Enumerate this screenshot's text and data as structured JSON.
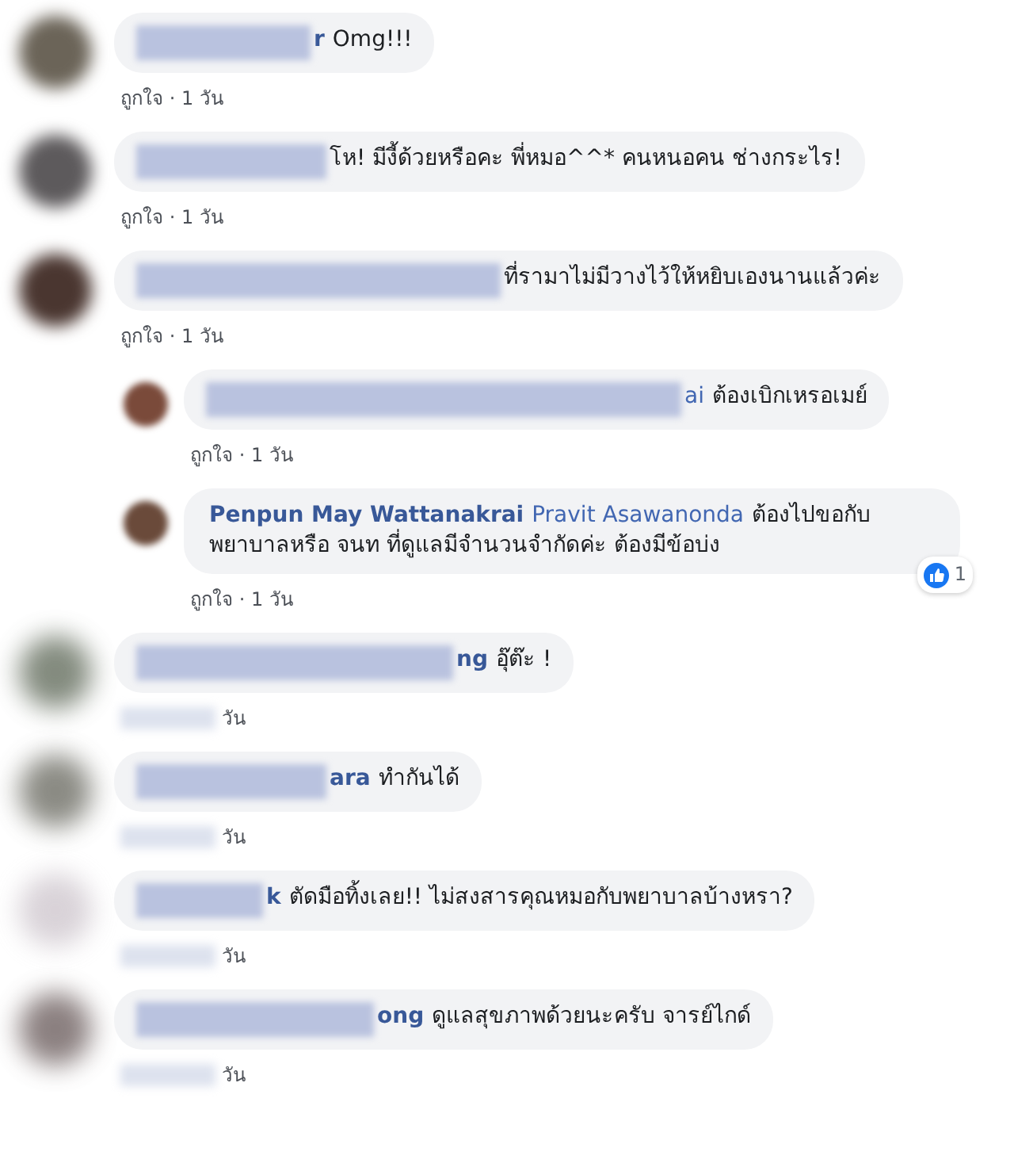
{
  "comments": [
    {
      "kind": "comment",
      "obscured": false,
      "name": "r",
      "text": "Omg!!!",
      "meta": "ถูกใจ · 1 วัน"
    },
    {
      "kind": "comment",
      "obscured": false,
      "text": "โห! มีงี้ด้วยหรือคะ พี่หมอ^^* คนหนอคน ช่างกระไร!",
      "meta": "ถูกใจ · 1 วัน"
    },
    {
      "kind": "comment",
      "obscured": false,
      "text": "ที่รามาไม่มีวางไว้ให้หยิบเองนานแล้วค่ะ",
      "meta": "ถูกใจ · 1 วัน"
    },
    {
      "kind": "reply",
      "obscured": false,
      "mention": "ai",
      "text": "ต้องเบิกเหรอเมย์",
      "meta": "ถูกใจ · 1 วัน"
    },
    {
      "kind": "reply",
      "obscured": false,
      "name": "Penpun May Wattanakrai",
      "mention": "Pravit Asawanonda",
      "text": "ต้องไปขอกับพยาบาลหรือ จนท ที่ดูแลมีจำนวนจำกัดค่ะ ต้องมีข้อบ่ง",
      "meta": "ถูกใจ · 1 วัน",
      "reactions": "1"
    },
    {
      "kind": "comment",
      "obscured": true,
      "name": "ng",
      "text": "อุ๊ต๊ะ !",
      "meta": "วัน"
    },
    {
      "kind": "comment",
      "obscured": true,
      "name": "ara",
      "text": "ทำกันได้",
      "meta": "วัน"
    },
    {
      "kind": "comment",
      "obscured": true,
      "name": "k",
      "text": "ตัดมือทิ้งเลย!! ไม่สงสารคุณหมอกับพยาบาลบ้างหรา?",
      "meta": "วัน"
    },
    {
      "kind": "comment",
      "obscured": true,
      "name": "ong",
      "text": "ดูแลสุขภาพด้วยนะครับ จารย์ไกด์",
      "meta": "วัน"
    }
  ]
}
